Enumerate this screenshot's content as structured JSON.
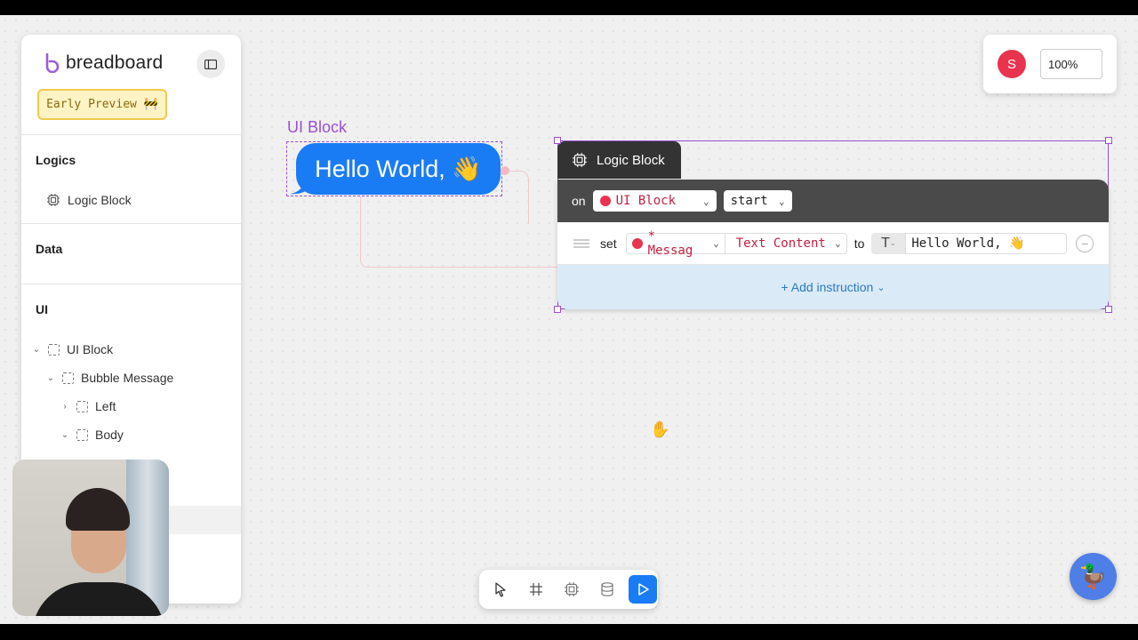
{
  "app": {
    "brand_name": "breadboard",
    "preview_badge": "Early Preview 🚧"
  },
  "sidebar": {
    "sections": {
      "logics": "Logics",
      "data": "Data",
      "ui": "UI"
    },
    "logics_items": [
      {
        "label": "Logic Block"
      }
    ],
    "ui_tree": [
      {
        "label": "UI Block",
        "expanded": true
      },
      {
        "label": "Bubble Message",
        "expanded": true
      },
      {
        "label": "Left",
        "expanded": false
      },
      {
        "label": "Body",
        "expanded": true
      }
    ]
  },
  "canvas": {
    "ui_block": {
      "label": "UI Block",
      "bubble_text": "Hello World, 👋"
    },
    "logic_block": {
      "title": "Logic Block",
      "trigger": {
        "on_label": "on",
        "source": "UI Block",
        "event": "start"
      },
      "instruction": {
        "verb": "set",
        "target": "* Messag",
        "property": "Text Content",
        "to_label": "to",
        "type_icon": "text-type-icon",
        "value": "Hello World, 👋"
      },
      "add_instruction": "+ Add instruction"
    }
  },
  "top_right": {
    "avatar_initial": "S",
    "zoom": "100%"
  },
  "colors": {
    "accent_blue": "#1a7cf5",
    "selection_purple": "#9b4fd0",
    "status_red": "#e8344e"
  }
}
